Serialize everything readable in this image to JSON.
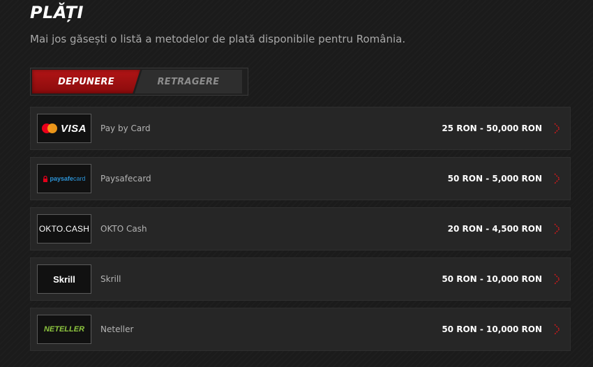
{
  "header": {
    "title": "PLĂȚI",
    "subtitle": "Mai jos găsești o listă a metodelor de plată disponibile pentru România."
  },
  "tabs": {
    "deposit_label": "DEPUNERE",
    "withdraw_label": "RETRAGERE",
    "active": "deposit"
  },
  "colors": {
    "accent": "#b21516",
    "chevron": "#d0191b",
    "mastercard_red": "#eb001b",
    "mastercard_orange": "#f79e1b",
    "paysafe_red": "#e2001a",
    "paysafe_blue": "#2c93d6",
    "neteller_green": "#8dc63f"
  },
  "methods": [
    {
      "name": "Pay by Card",
      "limits": "25 RON - 50,000 RON",
      "logo_text": "VISA",
      "icon": "visa-mastercard-logo"
    },
    {
      "name": "Paysafecard",
      "limits": "50 RON - 5,000 RON",
      "logo_text_a": "paysafe",
      "logo_text_b": "card",
      "icon": "paysafecard-logo"
    },
    {
      "name": "OKTO Cash",
      "limits": "20 RON - 4,500 RON",
      "logo_text": "OKTO.CASH",
      "icon": "okto-cash-logo"
    },
    {
      "name": "Skrill",
      "limits": "50 RON - 10,000 RON",
      "logo_text": "Skrill",
      "icon": "skrill-logo"
    },
    {
      "name": "Neteller",
      "limits": "50 RON - 10,000 RON",
      "logo_text": "NETELLER",
      "icon": "neteller-logo"
    }
  ]
}
